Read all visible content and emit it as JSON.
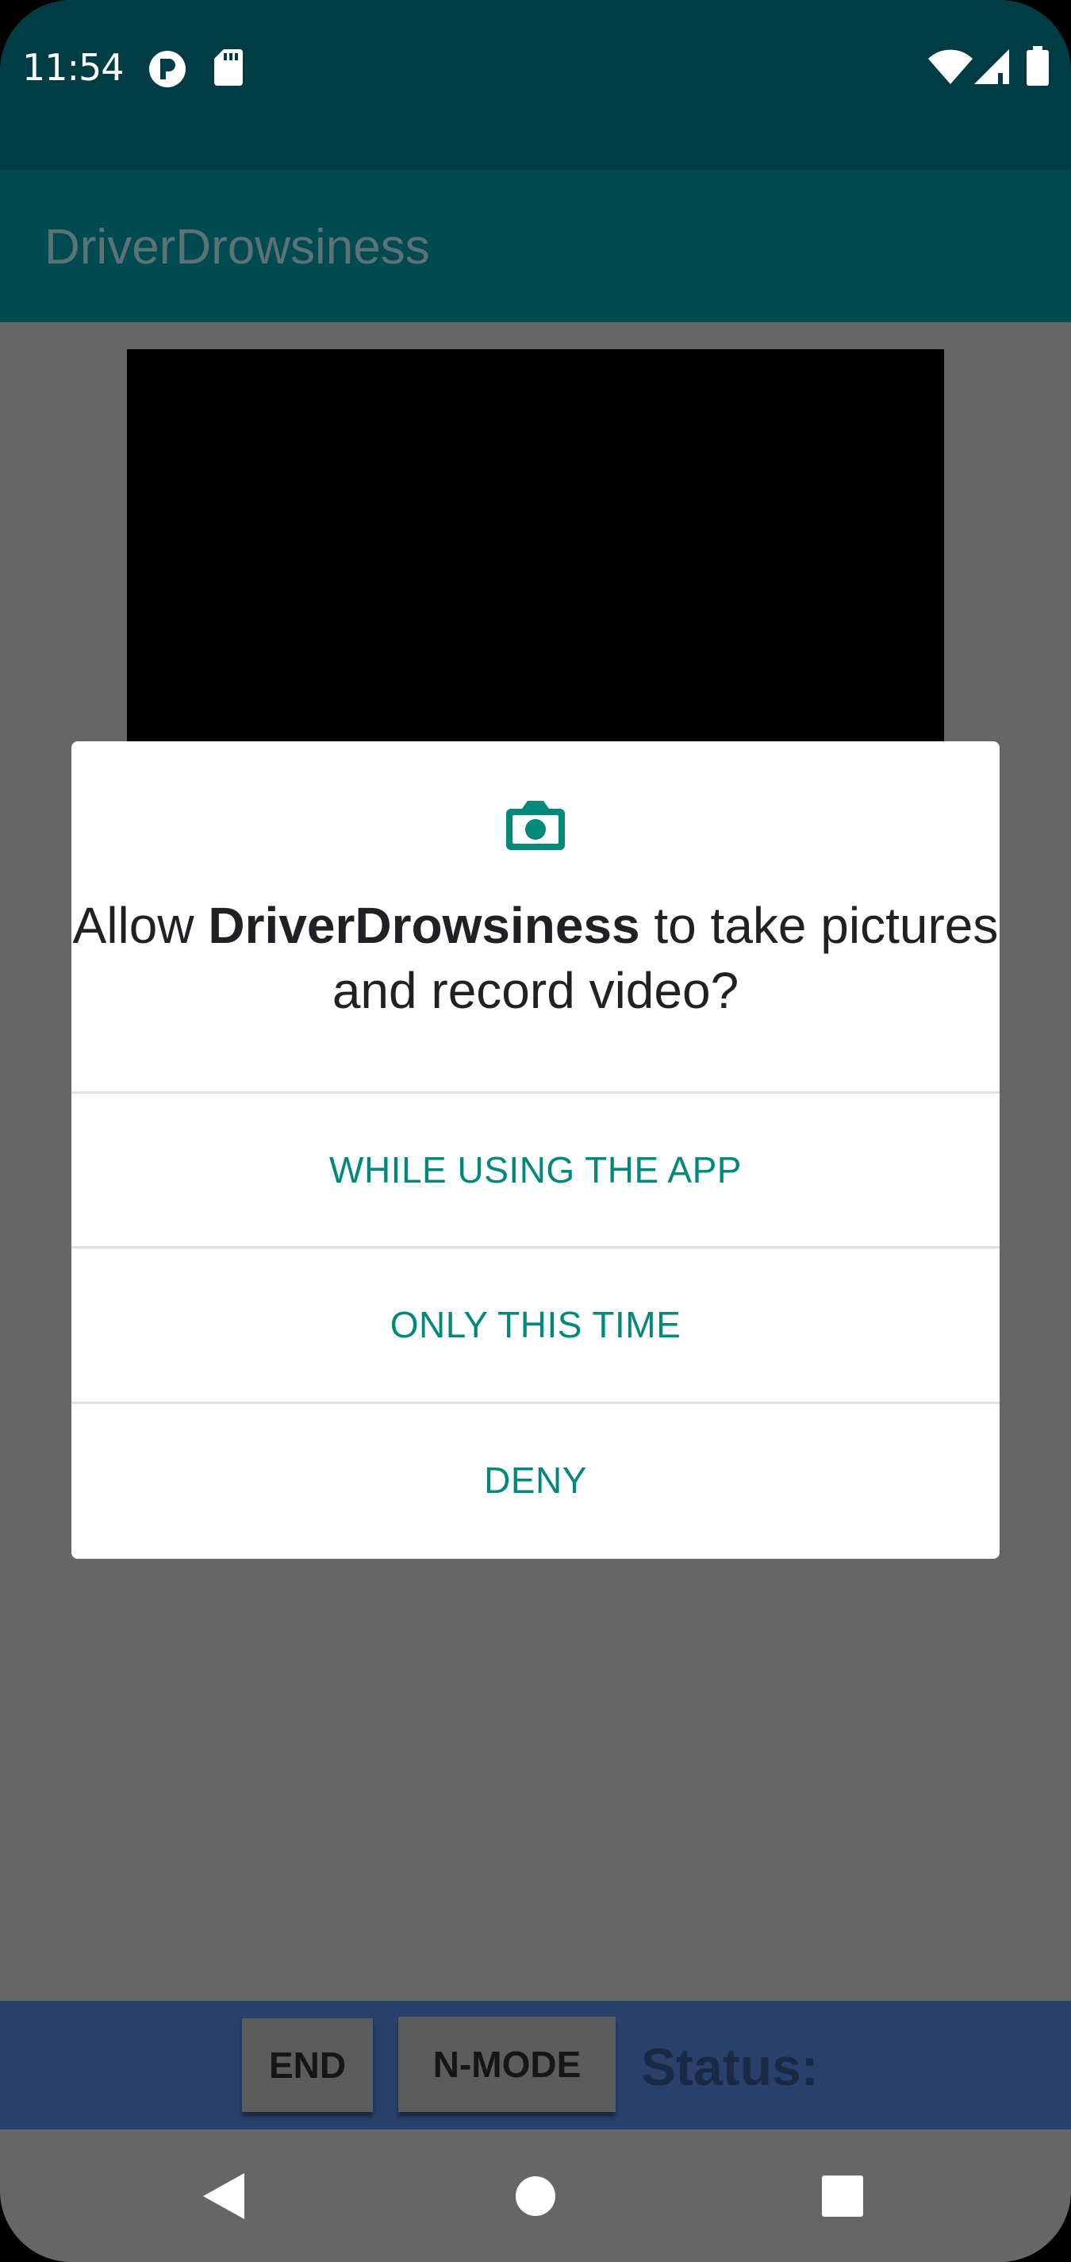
{
  "status_bar": {
    "time": "11:54",
    "icons": [
      "circle-p-icon",
      "sd-card-icon",
      "wifi-icon",
      "signal-icon",
      "battery-icon"
    ]
  },
  "app": {
    "title": "DriverDrowsiness"
  },
  "dialog": {
    "icon": "camera-icon",
    "title_prefix": "Allow ",
    "title_app": "DriverDrowsiness",
    "title_suffix": " to take pictures and record video?",
    "options": [
      {
        "label": "WHILE USING THE APP"
      },
      {
        "label": "ONLY THIS TIME"
      },
      {
        "label": "DENY"
      }
    ],
    "accent_color": "#00897b"
  },
  "bottom_bar": {
    "end_label": "END",
    "nmode_label": "N-MODE",
    "status_label": "Status:"
  },
  "nav": {
    "icons": [
      "back-icon",
      "home-icon",
      "recents-icon"
    ]
  },
  "colors": {
    "status_bar": "#003c43",
    "app_bar": "#004a51",
    "bottom_bar": "#28406a",
    "scrim_background": "#666666"
  }
}
